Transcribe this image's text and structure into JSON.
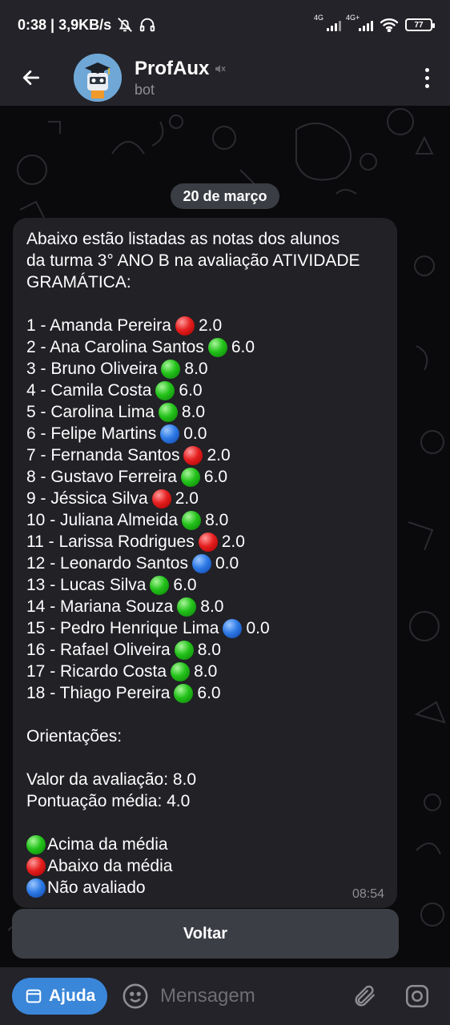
{
  "status_bar": {
    "time_and_speed": "0:38 | 3,9KB/s",
    "network_1": "4G",
    "network_2": "4G+",
    "battery": "77"
  },
  "header": {
    "title": "ProfAux",
    "subtitle": "bot"
  },
  "chat": {
    "date": "20 de março",
    "message": {
      "intro": [
        "Abaixo estão listadas as notas dos alunos",
        "da turma 3° ANO B na avaliação ATIVIDADE",
        "GRAMÁTICA:"
      ],
      "grades": [
        {
          "label": "1 - Amanda Pereira",
          "status": "red",
          "score": "2.0"
        },
        {
          "label": "2 - Ana Carolina Santos",
          "status": "green",
          "score": "6.0"
        },
        {
          "label": "3 - Bruno Oliveira",
          "status": "green",
          "score": "8.0"
        },
        {
          "label": "4 - Camila Costa",
          "status": "green",
          "score": "6.0"
        },
        {
          "label": "5 - Carolina Lima",
          "status": "green",
          "score": "8.0"
        },
        {
          "label": "6 - Felipe Martins",
          "status": "blue",
          "score": "0.0"
        },
        {
          "label": "7 - Fernanda Santos",
          "status": "red",
          "score": "2.0"
        },
        {
          "label": "8 - Gustavo Ferreira",
          "status": "green",
          "score": "6.0"
        },
        {
          "label": "9 - Jéssica Silva",
          "status": "red",
          "score": "2.0"
        },
        {
          "label": "10 - Juliana Almeida",
          "status": "green",
          "score": "8.0"
        },
        {
          "label": "11 - Larissa Rodrigues",
          "status": "red",
          "score": "2.0"
        },
        {
          "label": "12 - Leonardo Santos",
          "status": "blue",
          "score": "0.0"
        },
        {
          "label": "13 - Lucas Silva",
          "status": "green",
          "score": "6.0"
        },
        {
          "label": "14 - Mariana Souza",
          "status": "green",
          "score": "8.0"
        },
        {
          "label": "15 - Pedro Henrique Lima",
          "status": "blue",
          "score": "0.0"
        },
        {
          "label": "16 - Rafael Oliveira",
          "status": "green",
          "score": "8.0"
        },
        {
          "label": "17 - Ricardo Costa",
          "status": "green",
          "score": "8.0"
        },
        {
          "label": "18 - Thiago Pereira",
          "status": "green",
          "score": "6.0"
        }
      ],
      "orientations_heading": "Orientações:",
      "value_line": "Valor da avaliação: 8.0",
      "average_line": "Pontuação média: 4.0",
      "legend": [
        {
          "status": "green",
          "label": "Acima da média"
        },
        {
          "status": "red",
          "label": "Abaixo da média"
        },
        {
          "status": "blue",
          "label": "Não avaliado"
        }
      ],
      "time": "08:54"
    },
    "voltar_button": "Voltar"
  },
  "input_bar": {
    "ajuda_button": "Ajuda",
    "placeholder": "Mensagem"
  },
  "colors": {
    "accent": "#3a86d9",
    "bubble": "#212126",
    "header": "#232329"
  }
}
